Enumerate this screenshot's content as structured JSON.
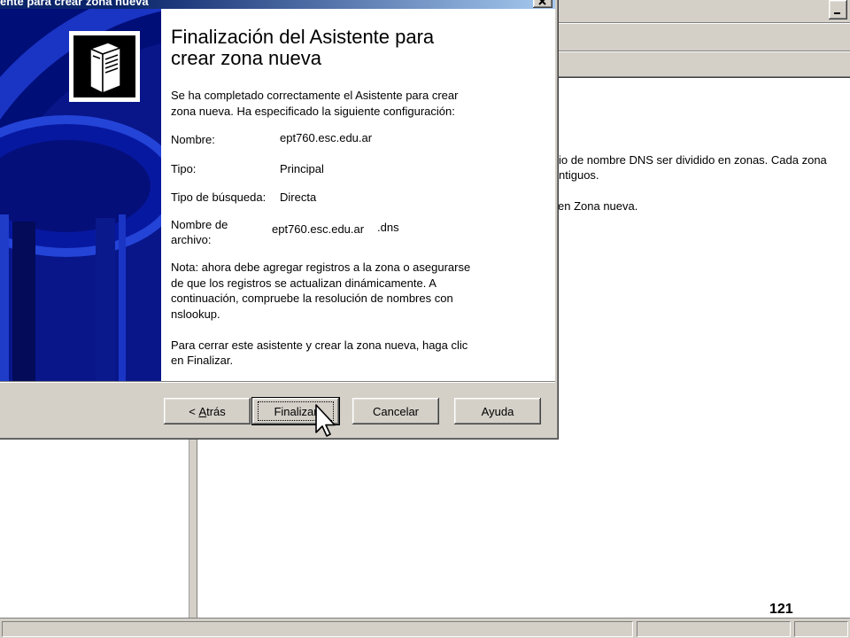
{
  "colors": {
    "face": "#d4d0c8",
    "title_dark": "#0a246a",
    "title_light": "#a6caf0",
    "panel_navy": "#000e78"
  },
  "background_window": {
    "minimize_icon": "minimize-icon",
    "content_lines": [
      "io de nombre DNS ser dividido en zonas. Cada zona",
      "ntiguos.",
      "en Zona nueva."
    ]
  },
  "wizard": {
    "title_bar": "ente para crear zona nueva",
    "close_icon": "close-icon",
    "side_icon": "dns-server-icon",
    "heading": [
      "Finalización del Asistente para",
      "crear zona nueva"
    ],
    "intro": [
      "Se ha completado correctamente el Asistente para crear",
      "zona nueva. Ha especificado la siguiente configuración:"
    ],
    "settings": [
      {
        "label_lines": [
          "Nombre:"
        ],
        "value": "ept760.esc.edu.ar"
      },
      {
        "label_lines": [
          "Tipo:"
        ],
        "value": "Principal"
      },
      {
        "label_lines": [
          "Tipo de búsqueda:"
        ],
        "value": "Directa"
      },
      {
        "label_lines": [
          "Nombre de",
          "archivo:"
        ],
        "value": "ept760.esc.edu.ar",
        "value_suffix": ".dns"
      }
    ],
    "note": [
      "Nota: ahora debe agregar registros a la zona o asegurarse",
      "de que los registros se actualizan dinámicamente. A",
      "continuación, compruebe la resolución de nombres con",
      "nslookup."
    ],
    "closing": [
      "Para cerrar este asistente y crear la zona nueva, haga clic",
      "en Finalizar."
    ],
    "buttons": {
      "back": {
        "prefix": "< ",
        "accel": "A",
        "rest": "trás"
      },
      "finish": "Finalizar",
      "cancel": "Cancelar",
      "help": "Ayuda"
    }
  },
  "cursor_icon": "arrow-cursor-icon",
  "page_number": "121"
}
